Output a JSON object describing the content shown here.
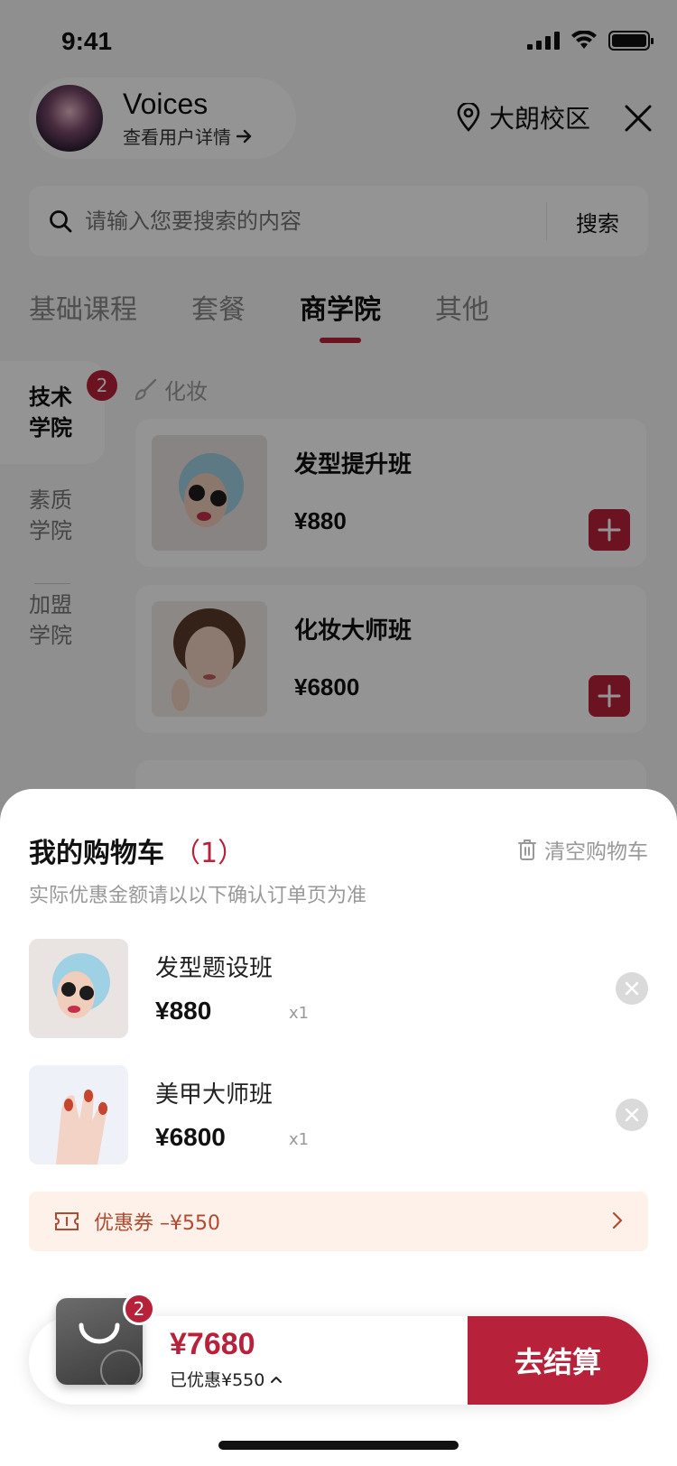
{
  "status_bar": {
    "time": "9:41"
  },
  "header": {
    "user_name": "Voices",
    "user_link": "查看用户详情",
    "location": "大朗校区"
  },
  "search": {
    "placeholder": "请输入您要搜索的内容",
    "button": "搜索"
  },
  "tabs": [
    {
      "label": "基础课程"
    },
    {
      "label": "套餐"
    },
    {
      "label": "商学院",
      "active": true
    },
    {
      "label": "其他"
    }
  ],
  "sidebar": {
    "badge": "2",
    "items": [
      {
        "label": "技术\n学院",
        "active": true
      },
      {
        "label": "素质\n学院"
      },
      {
        "label": "加盟\n学院"
      }
    ]
  },
  "category": {
    "label": "化妆",
    "icon": "brush-icon"
  },
  "products": [
    {
      "name": "发型提升班",
      "price": "¥880"
    },
    {
      "name": "化妆大师班",
      "price": "¥6800"
    }
  ],
  "cart": {
    "title": "我的购物车",
    "count": "（1）",
    "clear_label": "清空购物车",
    "note": "实际优惠金额请以以下确认订单页为准",
    "items": [
      {
        "name": "发型题设班",
        "price": "¥880",
        "qty": "x1"
      },
      {
        "name": "美甲大师班",
        "price": "¥6800",
        "qty": "x1"
      }
    ],
    "coupon": "优惠券 –¥550"
  },
  "checkout": {
    "badge": "2",
    "total": "¥7680",
    "saved": "已优惠¥550",
    "button": "去结算"
  },
  "colors": {
    "accent": "#b8213a",
    "coupon_bg": "#fdf1ea",
    "coupon_text": "#b04a30"
  }
}
